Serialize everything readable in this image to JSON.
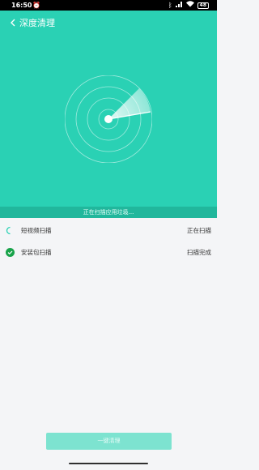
{
  "status_bar": {
    "time": "16:50",
    "battery": "48"
  },
  "header": {
    "title": "深度清理"
  },
  "scan": {
    "status_text": "正在扫描应用垃圾..."
  },
  "items": [
    {
      "label": "短视频扫描",
      "status": "正在扫描",
      "state": "scanning"
    },
    {
      "label": "安装包扫描",
      "status": "扫描完成",
      "state": "done"
    }
  ],
  "actions": {
    "cleanup_label": "一键清理"
  },
  "colors": {
    "accent": "#2ad1b4",
    "scan_bar": "#21b79c",
    "done_green": "#18a34a",
    "button_disabled": "#7de3d0"
  }
}
